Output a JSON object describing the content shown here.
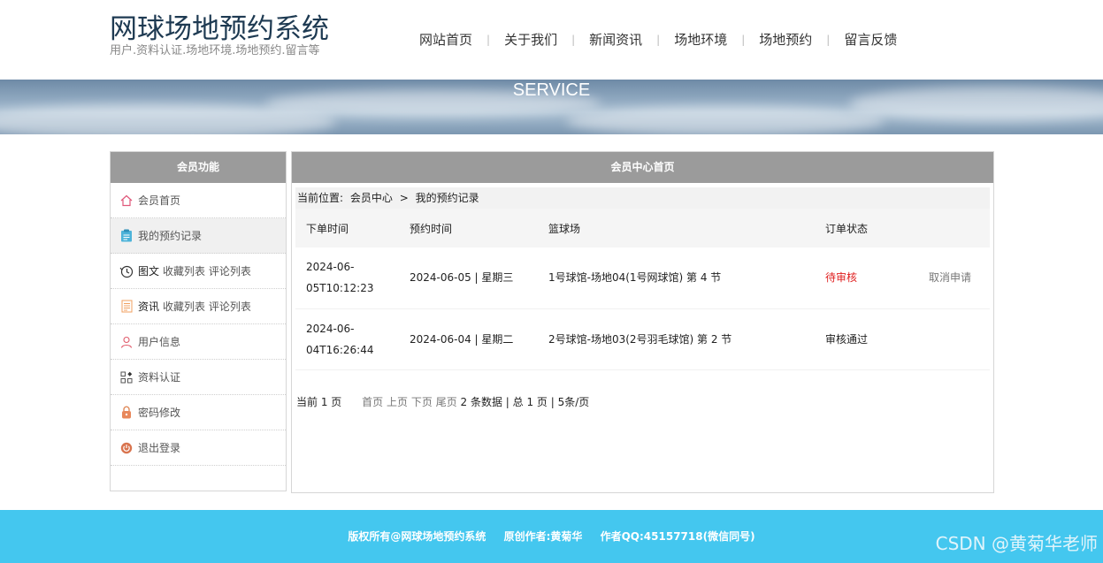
{
  "brand": {
    "title": "网球场地预约系统",
    "subtitle": "用户.资料认证.场地环境.场地预约.留言等"
  },
  "nav": [
    "网站首页",
    "关于我们",
    "新闻资讯",
    "场地环境",
    "场地预约",
    "留言反馈"
  ],
  "banner": {
    "title": "SERVICE"
  },
  "sidebar": {
    "title": "会员功能",
    "items": [
      {
        "icon": "home-icon",
        "label": "会员首页"
      },
      {
        "icon": "clipboard-icon",
        "label": "我的预约记录",
        "active": true
      },
      {
        "icon": "history-icon",
        "prefix": "图文",
        "label": "收藏列表 评论列表"
      },
      {
        "icon": "document-icon",
        "prefix": "资讯",
        "label": "收藏列表 评论列表"
      },
      {
        "icon": "user-icon",
        "label": "用户信息"
      },
      {
        "icon": "apps-icon",
        "label": "资料认证"
      },
      {
        "icon": "lock-icon",
        "label": "密码修改"
      },
      {
        "icon": "power-icon",
        "label": "退出登录"
      }
    ]
  },
  "main": {
    "title": "会员中心首页",
    "breadcrumb": {
      "label": "当前位置:",
      "level1": "会员中心",
      "sep": ">",
      "level2": "我的预约记录"
    },
    "columns": [
      "下单时间",
      "预约时间",
      "篮球场",
      "订单状态",
      ""
    ],
    "rows": [
      {
        "order_time_1": "2024-06-",
        "order_time_2": "05T10:12:23",
        "booking_time": "2024-06-05 | 星期三",
        "court": "1号球馆-场地04(1号网球馆) 第 4 节",
        "status": "待审核",
        "action": "取消申请"
      },
      {
        "order_time_1": "2024-06-",
        "order_time_2": "04T16:26:44",
        "booking_time": "2024-06-04 | 星期二",
        "court": "2号球馆-场地03(2号羽毛球馆) 第 2 节",
        "status": "审核通过",
        "action": ""
      }
    ],
    "pager": {
      "current": "当前 1 页",
      "first": "首页",
      "prev": "上页",
      "next": "下页",
      "last": "尾页",
      "summary": "2 条数据 | 总 1 页 | 5条/页"
    }
  },
  "footer": {
    "copyright": "版权所有@网球场地预约系统",
    "author": "原创作者:黄菊华",
    "qq": "作者QQ:45157718(微信同号)"
  },
  "watermark": "CSDN @黄菊华老师",
  "colors": {
    "footer": "#44c7ef",
    "panel_header": "#9b9b9b",
    "pending": "#e02020"
  }
}
